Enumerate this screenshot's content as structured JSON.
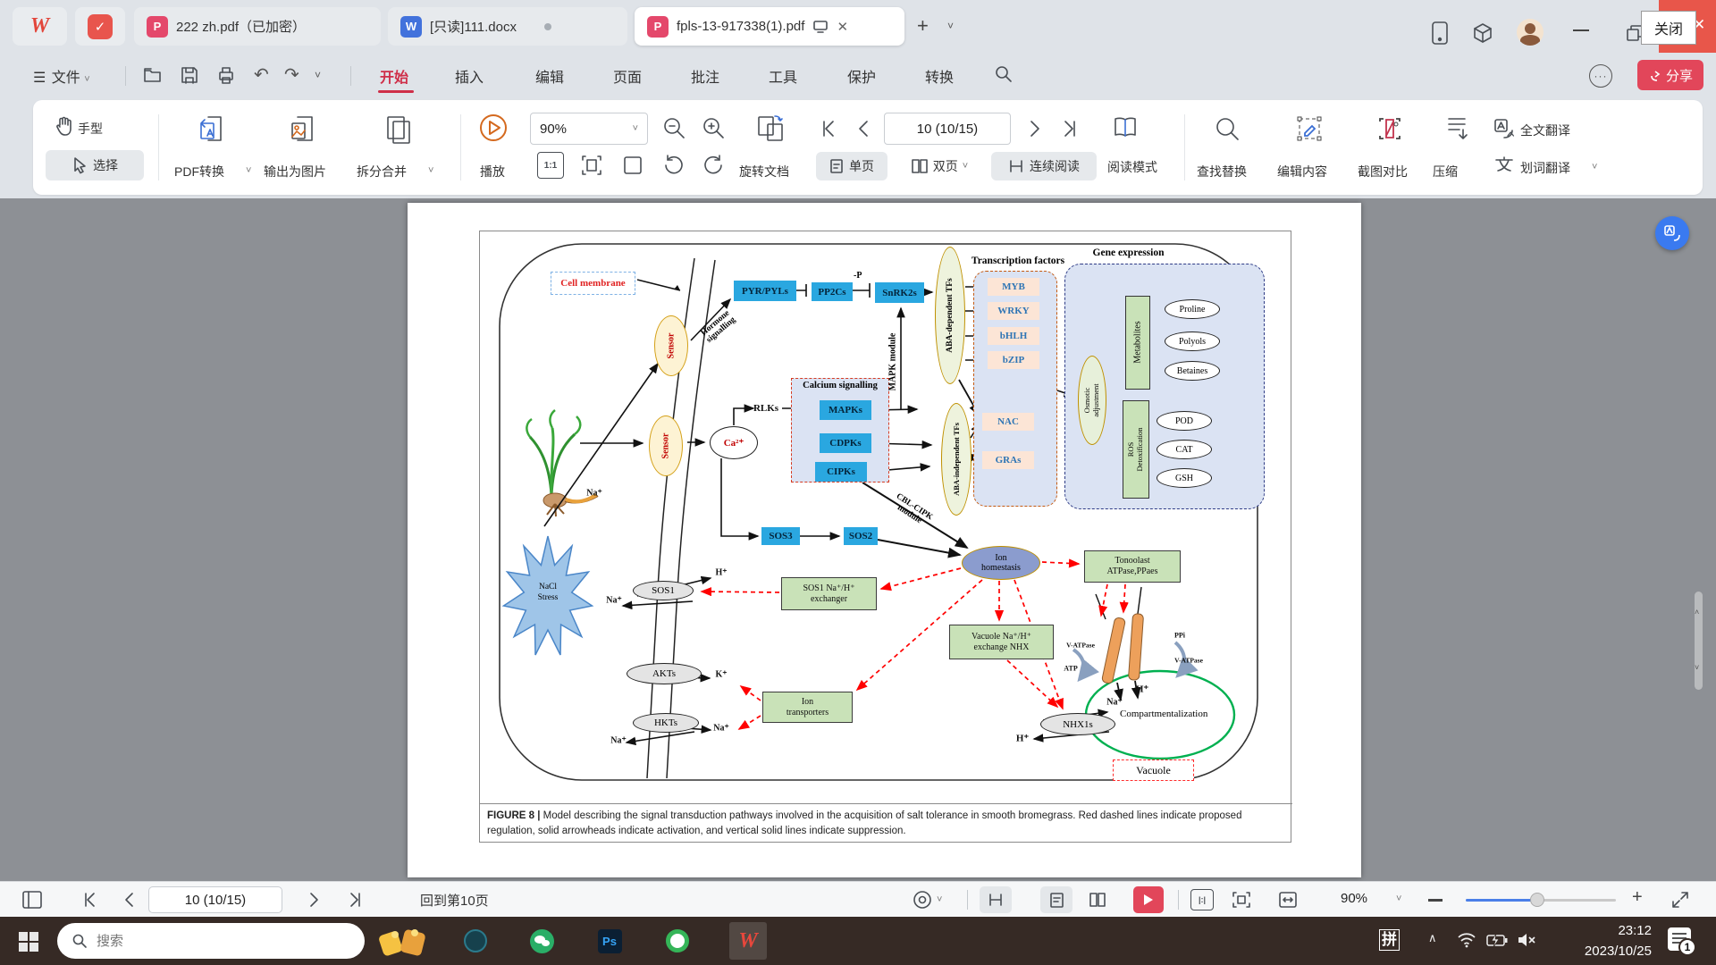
{
  "tabbar": {
    "tabs": [
      {
        "label": "222 zh.pdf（已加密）"
      },
      {
        "label": "[只读]111.docx"
      },
      {
        "label": "fpls-13-917338(1).pdf"
      }
    ],
    "close_tooltip": "关闭"
  },
  "menubar": {
    "file": "文件",
    "items": [
      "开始",
      "插入",
      "编辑",
      "页面",
      "批注",
      "工具",
      "保护",
      "转换"
    ],
    "share": "分享"
  },
  "ribbon": {
    "hand": "手型",
    "select": "选择",
    "pdf_convert": "PDF转换",
    "export_image": "输出为图片",
    "split_merge": "拆分合并",
    "play": "播放",
    "zoom_value": "90%",
    "rotate_doc": "旋转文档",
    "single_page": "单页",
    "double_page": "双页",
    "continuous": "连续阅读",
    "read_mode": "阅读模式",
    "page_indicator": "10 (10/15)",
    "find_replace": "查找替换",
    "edit_content": "编辑内容",
    "screenshot_compare": "截图对比",
    "compress": "压缩",
    "translate_full": "全文翻译",
    "translate_word": "划词翻译"
  },
  "figure": {
    "cell_membrane": "Cell membrane",
    "sensor": "Sensor",
    "hormone_signalling": "Hormone signalling",
    "pyr": "PYR/PYLs",
    "pp2cs": "PP2Cs",
    "snrk2s": "SnRK2s",
    "minus_p": "-P",
    "mapk_module": "MAPK module",
    "aba_dependent": "ABA-dependent TFs",
    "aba_independent": "ABA-independent TFs",
    "transcription_factors": "Transcription factors",
    "tf_items": [
      "MYB",
      "WRKY",
      "bHLH",
      "bZIP",
      "NAC",
      "GRAs"
    ],
    "gene_expression": "Gene expression",
    "osmotic_1": "Osmotic",
    "osmotic_2": "adjustment",
    "metabolites": "Metabolites",
    "ros_1": "ROS",
    "ros_2": "Detoxification",
    "metabolite_items": [
      "Proline",
      "Polyols",
      "Betaines"
    ],
    "ros_items": [
      "POD",
      "CAT",
      "GSH"
    ],
    "calcium_signalling": "Calcium signalling",
    "rlks": "RLKs",
    "ca": "Ca²⁺",
    "kinases": [
      "MAPKs",
      "CDPKs",
      "CIPKs"
    ],
    "cbl_1": "CBL-CIPK",
    "cbl_2": "module",
    "sos3": "SOS3",
    "sos2": "SOS2",
    "ion_homeostasis_1": "Ion",
    "ion_homeostasis_2": "homestasis",
    "tonoplast_1": "Tonoolast",
    "tonoplast_2": "ATPase,PPaes",
    "sos1_exchanger_1": "SOS1 Na⁺/H⁺",
    "sos1_exchanger_2": "exchanger",
    "vacuole_nhx_1": "Vacuole Na⁺/H⁺",
    "vacuole_nhx_2": "exchange NHX",
    "ion_transporters_1": "Ion",
    "ion_transporters_2": "transporters",
    "sos1": "SOS1",
    "akts": "AKTs",
    "hkts": "HKTs",
    "nhx1s": "NHX1s",
    "nacl_1": "NaCl",
    "nacl_2": "Stress",
    "v_atpase": "V-ATPase",
    "atp": "ATP",
    "ppi": "PPi",
    "compartmentalization": "Compartmentalization",
    "vacuole": "Vacuole",
    "na": "Na⁺",
    "h": "H⁺",
    "k": "K⁺",
    "caption_label": "FIGURE 8 |",
    "caption_text": "Model describing the signal transduction pathways involved in the acquisition of salt tolerance in smooth bromegrass. Red dashed lines indicate proposed regulation, solid arrowheads indicate activation, and vertical solid lines indicate suppression."
  },
  "statusbar": {
    "page_indicator": "10 (10/15)",
    "back_to": "回到第10页",
    "zoom_value": "90%"
  },
  "taskbar": {
    "search_placeholder": "搜索",
    "ime": "拼",
    "time": "23:12",
    "date": "2023/10/25",
    "badge": "1"
  }
}
